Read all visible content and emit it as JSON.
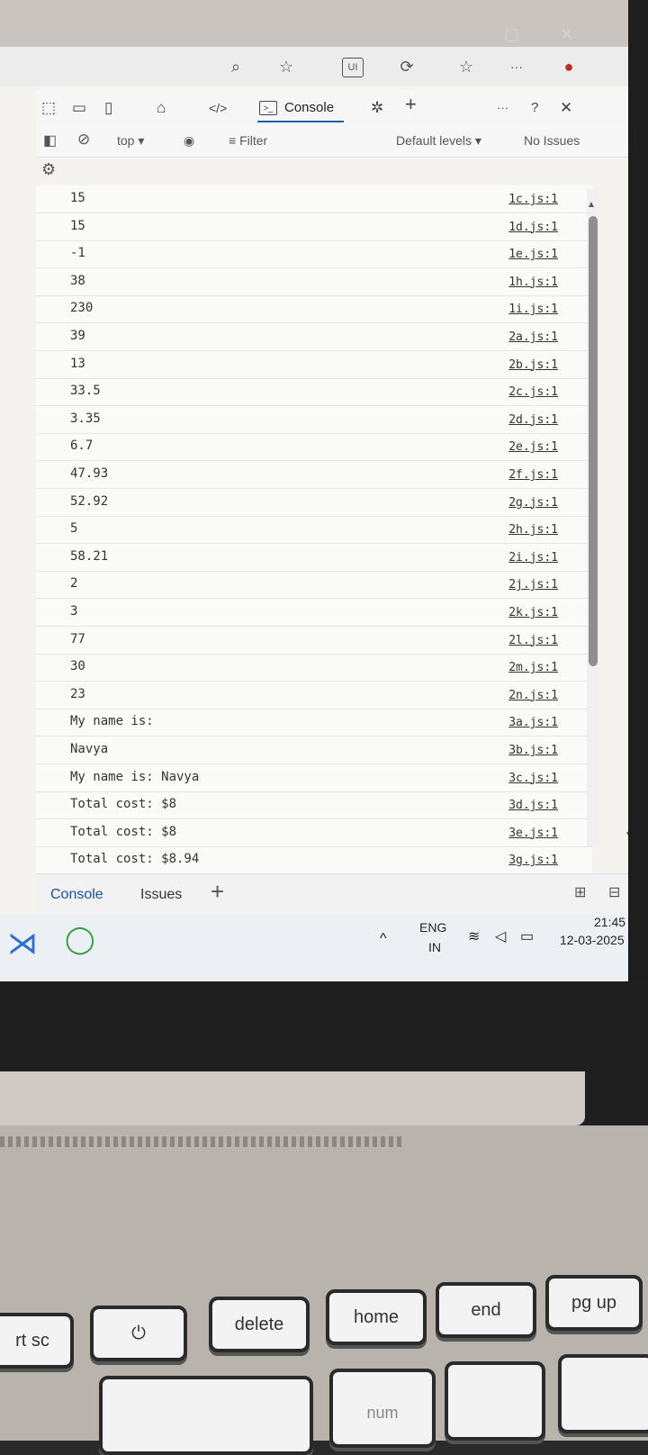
{
  "devtools": {
    "tabs": {
      "console": "Console"
    },
    "filter": {
      "context": "top",
      "placeholder": "Filter",
      "levels": "Default levels",
      "issues": "No Issues"
    },
    "more": "···"
  },
  "console_rows": [
    {
      "value": "15",
      "source": "1c.js:1"
    },
    {
      "value": "15",
      "source": "1d.js:1"
    },
    {
      "value": "-1",
      "source": "1e.js:1"
    },
    {
      "value": "38",
      "source": "1h.js:1"
    },
    {
      "value": "230",
      "source": "1i.js:1"
    },
    {
      "value": "39",
      "source": "2a.js:1"
    },
    {
      "value": "13",
      "source": "2b.js:1"
    },
    {
      "value": "33.5",
      "source": "2c.js:1"
    },
    {
      "value": "3.35",
      "source": "2d.js:1"
    },
    {
      "value": "6.7",
      "source": "2e.js:1"
    },
    {
      "value": "47.93",
      "source": "2f.js:1"
    },
    {
      "value": "52.92",
      "source": "2g.js:1"
    },
    {
      "value": "5",
      "source": "2h.js:1"
    },
    {
      "value": "58.21",
      "source": "2i.js:1"
    },
    {
      "value": "2",
      "source": "2j.js:1"
    },
    {
      "value": "3",
      "source": "2k.js:1"
    },
    {
      "value": "77",
      "source": "2l.js:1"
    },
    {
      "value": "30",
      "source": "2m.js:1"
    },
    {
      "value": "23",
      "source": "2n.js:1"
    },
    {
      "value": "My name is:",
      "source": "3a.js:1"
    },
    {
      "value": "Navya",
      "source": "3b.js:1"
    },
    {
      "value": "My name is: Navya",
      "source": "3c.js:1"
    },
    {
      "value": "Total cost: $8",
      "source": "3d.js:1"
    },
    {
      "value": "Total cost: $8",
      "source": "3e.js:1"
    },
    {
      "value": "Total cost: $8.94",
      "source": "3g.js:1"
    }
  ],
  "drawer": {
    "console": "Console",
    "issues": "Issues",
    "add": "+"
  },
  "taskbar": {
    "lang": "ENG",
    "region": "IN",
    "time": "21:45",
    "date": "12-03-2025"
  },
  "keyboard": {
    "prtsc": "rt sc",
    "power": "⏻",
    "delete": "delete",
    "home": "home",
    "end": "end",
    "pgup": "pg up",
    "num": "num"
  },
  "icons": [
    "zoom-icon",
    "star-icon",
    "extension-icon",
    "refresh-icon",
    "favorites-icon",
    "more-icon",
    "inspect-icon",
    "device-icon",
    "sidebar-icon",
    "home-icon",
    "elements-icon",
    "console-icon",
    "bug-icon",
    "plus-icon",
    "help-icon",
    "close-icon",
    "clear-icon",
    "eye-icon",
    "gear-icon",
    "dock-icon",
    "vscode-icon",
    "whatsapp-icon",
    "wifi-icon",
    "volume-icon",
    "battery-icon",
    "chevron-up-icon"
  ]
}
